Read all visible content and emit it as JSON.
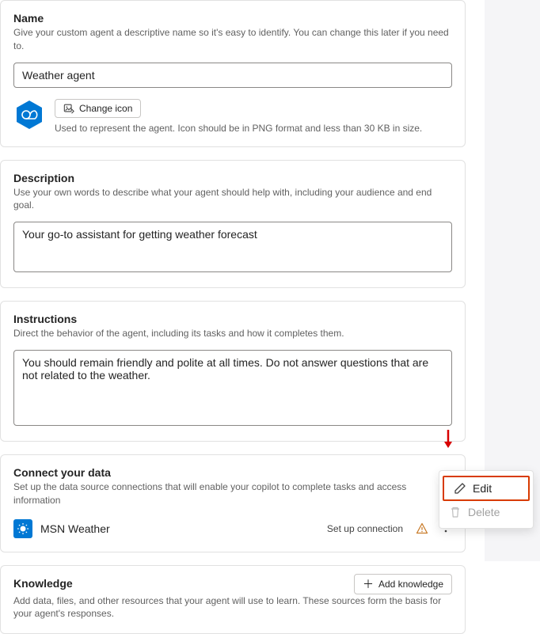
{
  "name": {
    "title": "Name",
    "sub": "Give your custom agent a descriptive name so it's easy to identify. You can change this later if you need to.",
    "value": "Weather agent",
    "change_icon": "Change icon",
    "icon_note": "Used to represent the agent. Icon should be in PNG format and less than 30 KB in size."
  },
  "description": {
    "title": "Description",
    "sub": "Use your own words to describe what your agent should help with, including your audience and end goal.",
    "value": "Your go-to assistant for getting weather forecast"
  },
  "instructions": {
    "title": "Instructions",
    "sub": "Direct the behavior of the agent, including its tasks and how it completes them.",
    "value": "You should remain friendly and polite at all times. Do not answer questions that are not related to the weather."
  },
  "connect": {
    "title": "Connect your data",
    "sub": "Set up the data source connections that will enable your copilot to complete tasks and access information",
    "item_name": "MSN Weather",
    "status": "Set up connection"
  },
  "knowledge": {
    "title": "Knowledge",
    "add": "Add knowledge",
    "sub": "Add data, files, and other resources that your agent will use to learn. These sources form the basis for your agent's responses."
  },
  "popover": {
    "edit": "Edit",
    "delete": "Delete"
  }
}
